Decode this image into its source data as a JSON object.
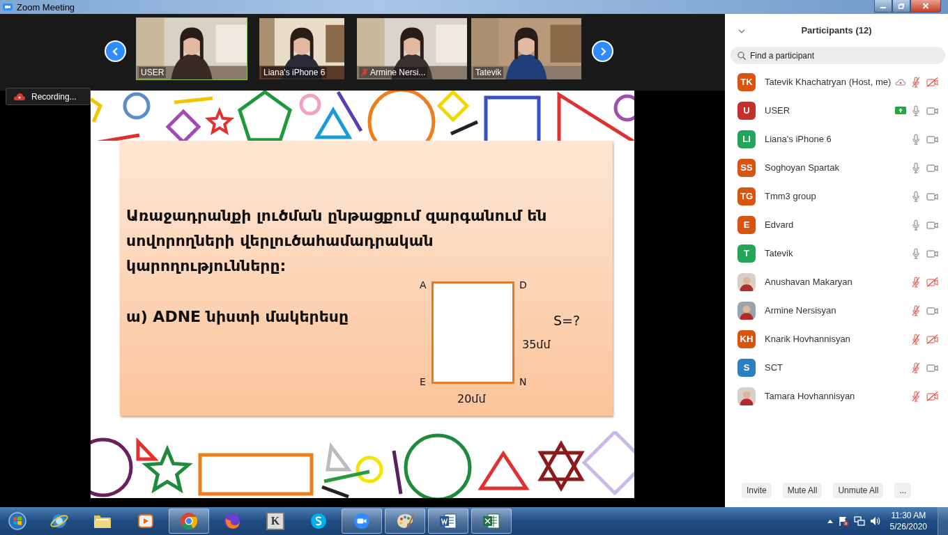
{
  "window": {
    "title": "Zoom Meeting"
  },
  "videos": [
    {
      "label": "USER",
      "speaking": true,
      "muted": false
    },
    {
      "label": "Liana's iPhone 6",
      "speaking": false,
      "muted": false
    },
    {
      "label": "Armine Nersi...",
      "speaking": false,
      "muted": true
    },
    {
      "label": "Tatevik",
      "speaking": false,
      "muted": false
    }
  ],
  "recording": {
    "label": "Recording..."
  },
  "slide": {
    "paragraph": "Առաջադրանքի լուծման ընթացքում  զարգանում են սովորողների վերլուծահամադրական կարողությունները:",
    "task": "ա) ADNE նիստի մակերեսը",
    "figure": {
      "corners": [
        "A",
        "D",
        "E",
        "N"
      ],
      "side_label": "35մմ",
      "bottom_label": "20մմ",
      "question": "S=?"
    }
  },
  "participants": {
    "title": "Participants (12)",
    "search": {
      "placeholder": "Find a participant"
    },
    "people": [
      {
        "kind": "initials",
        "initials": "TK",
        "color": "#d9540f",
        "name": "Tatevik Khachatryan (Host, me)",
        "recording": true,
        "sharing": false,
        "mic_muted": true,
        "video_off": true
      },
      {
        "kind": "initials",
        "initials": "U",
        "color": "#c4302b",
        "name": "USER",
        "recording": false,
        "sharing": true,
        "mic_muted": false,
        "video_off": false
      },
      {
        "kind": "initials",
        "initials": "LI",
        "color": "#23a55a",
        "name": "Liana's iPhone 6",
        "recording": false,
        "sharing": false,
        "mic_muted": false,
        "video_off": false
      },
      {
        "kind": "initials",
        "initials": "SS",
        "color": "#d9540f",
        "name": "Soghoyan Spartak",
        "recording": false,
        "sharing": false,
        "mic_muted": false,
        "video_off": false
      },
      {
        "kind": "initials",
        "initials": "TG",
        "color": "#d9540f",
        "name": "Tmm3 group",
        "recording": false,
        "sharing": false,
        "mic_muted": false,
        "video_off": false
      },
      {
        "kind": "initials",
        "initials": "E",
        "color": "#d9540f",
        "name": "Edvard",
        "recording": false,
        "sharing": false,
        "mic_muted": false,
        "video_off": false
      },
      {
        "kind": "initials",
        "initials": "T",
        "color": "#23a55a",
        "name": "Tatevik",
        "recording": false,
        "sharing": false,
        "mic_muted": false,
        "video_off": false
      },
      {
        "name": "Anushavan Makaryan",
        "recording": false,
        "sharing": false,
        "mic_muted": true,
        "video_off": true
      },
      {
        "name": "Armine Nersisyan",
        "recording": false,
        "sharing": false,
        "mic_muted": true,
        "video_off": false
      },
      {
        "kind": "initials",
        "initials": "KH",
        "color": "#d9540f",
        "name": "Knarik Hovhannisyan",
        "recording": false,
        "sharing": false,
        "mic_muted": true,
        "video_off": true
      },
      {
        "kind": "initials",
        "initials": "S",
        "color": "#2e7fc1",
        "name": "SCT",
        "recording": false,
        "sharing": false,
        "mic_muted": true,
        "video_off": false
      },
      {
        "name": "Tamara Hovhannisyan",
        "recording": false,
        "sharing": false,
        "mic_muted": true,
        "video_off": true
      }
    ],
    "buttons": [
      "Invite",
      "Mute All",
      "Unmute All",
      "..."
    ]
  },
  "taskbar": {
    "apps": [
      {
        "kind": "ie",
        "running": false
      },
      {
        "kind": "folder",
        "running": false
      },
      {
        "kind": "media",
        "running": false
      },
      {
        "kind": "chrome",
        "running": true
      },
      {
        "kind": "firefox",
        "running": false
      },
      {
        "kind": "glyph",
        "glyph": "K",
        "running": false
      },
      {
        "kind": "skype",
        "running": false
      },
      {
        "kind": "zoom",
        "running": true
      },
      {
        "kind": "paint",
        "running": true
      },
      {
        "kind": "word",
        "running": true
      },
      {
        "kind": "excel",
        "running": true
      }
    ],
    "time": "11:30 AM",
    "date": "5/26/2020"
  }
}
